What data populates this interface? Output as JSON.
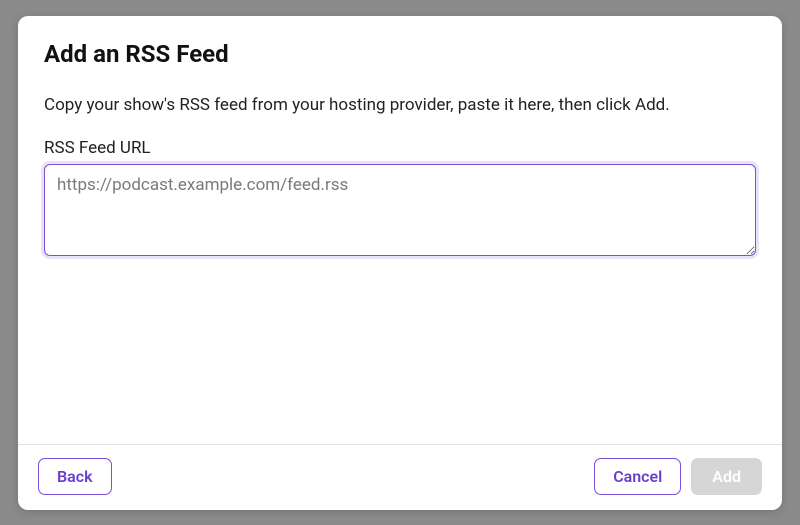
{
  "modal": {
    "title": "Add an RSS Feed",
    "description": "Copy your show's RSS feed from your hosting provider, paste it here, then click Add.",
    "field_label": "RSS Feed URL",
    "placeholder": "https://podcast.example.com/feed.rss",
    "value": ""
  },
  "buttons": {
    "back": "Back",
    "cancel": "Cancel",
    "add": "Add"
  }
}
